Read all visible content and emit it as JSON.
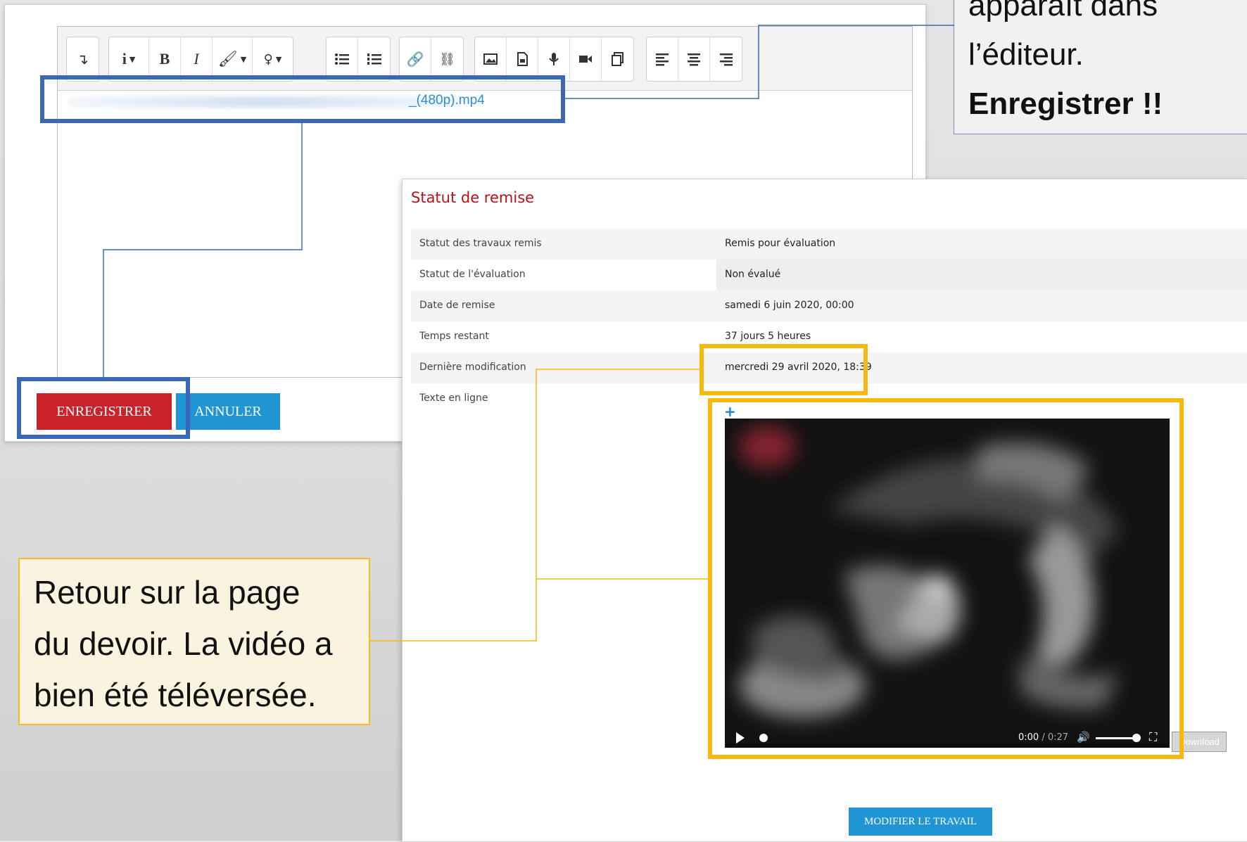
{
  "editor": {
    "file_link": "_(480p).mp4",
    "save_label": "ENREGISTRER",
    "cancel_label": "ANNULER"
  },
  "status": {
    "title": "Statut de remise",
    "rows": [
      {
        "label": "Statut des travaux remis",
        "value": "Remis pour évaluation"
      },
      {
        "label": "Statut de l'évaluation",
        "value": "Non évalué"
      },
      {
        "label": "Date de remise",
        "value": "samedi 6 juin 2020, 00:00"
      },
      {
        "label": "Temps restant",
        "value": "37 jours 5 heures"
      },
      {
        "label": "Dernière modification",
        "value": "mercredi 29 avril 2020, 18:39"
      },
      {
        "label": "Texte en ligne",
        "value": ""
      }
    ],
    "video": {
      "time_current": "0:00",
      "time_separator": "/",
      "time_total": "0:27",
      "download_label": "Download"
    },
    "modify_label": "MODIFIER LE TRAVAIL"
  },
  "callout_top": {
    "line1": "apparaît dans",
    "line2": "l’éditeur.",
    "line3": "Enregistrer !!"
  },
  "callout_bottom": {
    "line1": "Retour sur la page",
    "line2": "du devoir. La vidéo a",
    "line3": "bien été téléversée."
  },
  "colors": {
    "save_red": "#c9222a",
    "cancel_blue": "#1f96d3",
    "title_red": "#b5121b",
    "highlight_blue": "#3b68b4",
    "highlight_yellow": "#f5b90f"
  }
}
